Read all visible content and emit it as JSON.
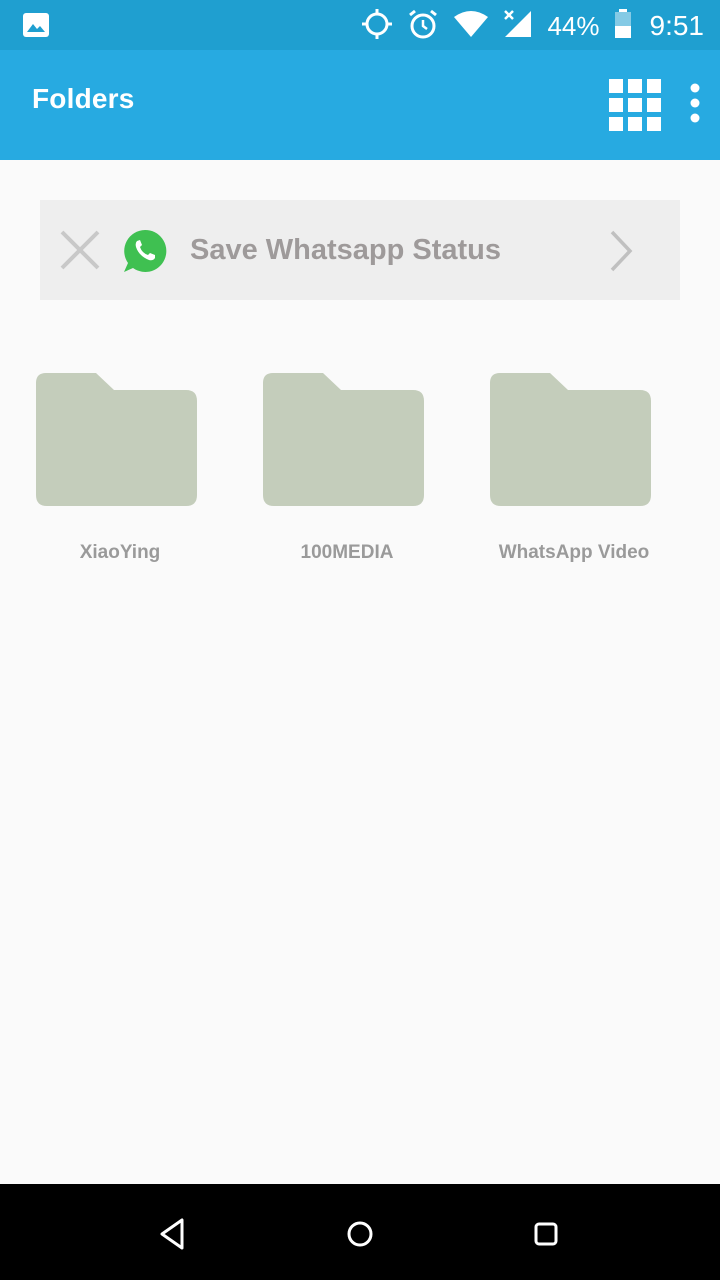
{
  "status_bar": {
    "battery": "44%",
    "time": "9:51",
    "icons": [
      "image-icon",
      "location-icon",
      "alarm-icon",
      "wifi-icon",
      "signal-icon",
      "battery-icon"
    ]
  },
  "app_bar": {
    "title": "Folders",
    "actions": [
      "grid-view-icon",
      "more-vert-icon"
    ]
  },
  "banner": {
    "label": "Save Whatsapp Status",
    "icons": [
      "close-icon",
      "whatsapp-icon",
      "chevron-right-icon"
    ]
  },
  "folders": [
    {
      "name": "XiaoYing"
    },
    {
      "name": "100MEDIA"
    },
    {
      "name": "WhatsApp Video"
    }
  ],
  "nav_bar": {
    "buttons": [
      "back-icon",
      "home-icon",
      "recents-icon"
    ]
  },
  "colors": {
    "status_bar": "#1f9fd0",
    "app_bar": "#27aae1",
    "folder": "#c4cdbb",
    "whatsapp_green": "#3fc051",
    "banner_bg": "#eeeeee"
  }
}
